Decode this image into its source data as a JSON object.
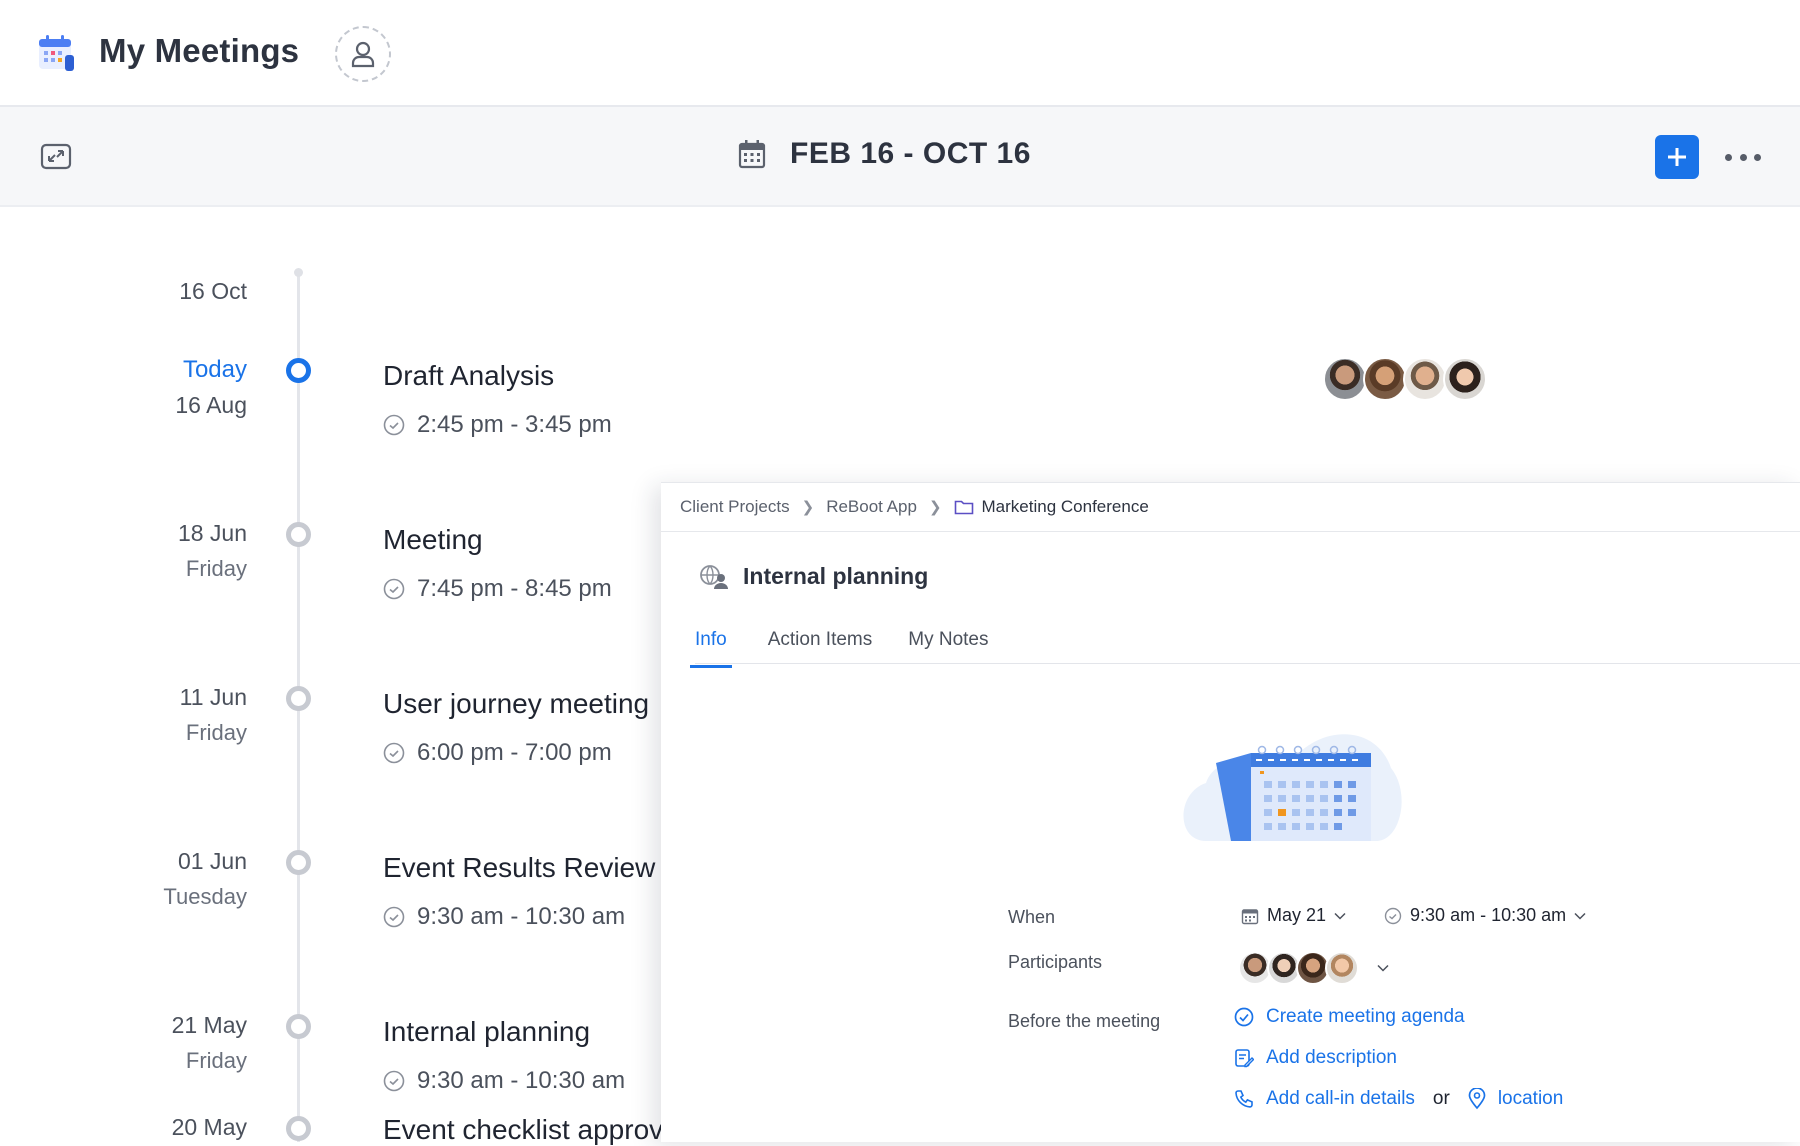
{
  "app": {
    "title": "My Meetings",
    "icon": "calendar-app-icon",
    "profile_icon": "user-icon"
  },
  "toolbar": {
    "date_range": "FEB 16 - OCT 16",
    "add_icon": "plus-icon",
    "more_icon": "ellipsis-icon",
    "expand_icon": "expand-icon"
  },
  "timeline": {
    "start_label": "16 Oct",
    "items": [
      {
        "date": "16 Aug",
        "day": "Today",
        "title": "Draft Analysis",
        "time": "2:45 pm - 3:45 pm",
        "active": true
      },
      {
        "date": "18 Jun",
        "day": "Friday",
        "title": "Meeting",
        "time": "7:45 pm - 8:45 pm"
      },
      {
        "date": "11 Jun",
        "day": "Friday",
        "title": "User journey meeting",
        "time": "6:00 pm - 7:00 pm"
      },
      {
        "date": "01 Jun",
        "day": "Tuesday",
        "title": "Event Results Review",
        "time": "9:30 am - 10:30 am"
      },
      {
        "date": "21 May",
        "day": "Friday",
        "title": "Internal planning",
        "time": "9:30 am - 10:30 am"
      },
      {
        "date": "20 May",
        "day": "",
        "title": "Event checklist approv",
        "time": ""
      }
    ]
  },
  "panel": {
    "breadcrumb": [
      "Client Projects",
      "ReBoot App",
      "Marketing Conference"
    ],
    "title": "Internal planning",
    "tabs": [
      "Info",
      "Action Items",
      "My Notes"
    ],
    "active_tab": "Info",
    "when_label": "When",
    "when_date": "May 21",
    "when_time": "9:30 am - 10:30 am",
    "participants_label": "Participants",
    "before_label": "Before the meeting",
    "actions": {
      "agenda": "Create meeting agenda",
      "description": "Add description",
      "callin": "Add call-in details",
      "or": "or",
      "location": "location"
    }
  },
  "colors": {
    "accent": "#1a73e8",
    "text": "#1f2430",
    "muted": "#4b515c",
    "node": "#c7cad1"
  }
}
